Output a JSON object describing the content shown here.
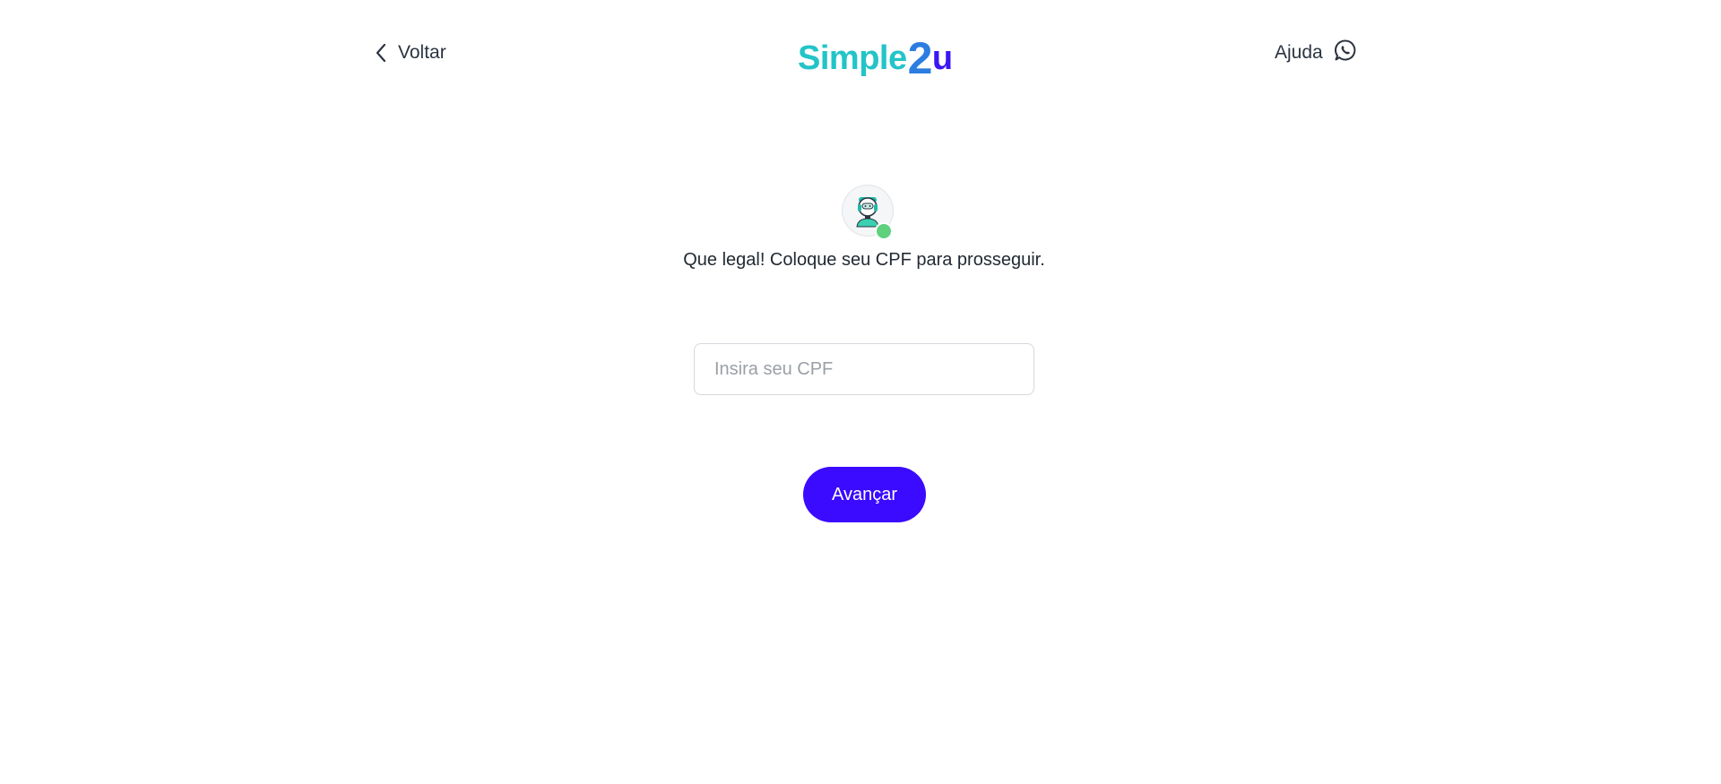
{
  "header": {
    "back_label": "Voltar",
    "help_label": "Ajuda",
    "logo": {
      "word": "Simple",
      "two": "2",
      "u": "u"
    },
    "icons": {
      "back": "chevron-left-icon",
      "help": "whatsapp-icon"
    }
  },
  "assistant": {
    "avatar_icon": "robot-avatar-icon",
    "status": "online"
  },
  "main": {
    "prompt": "Que legal! Coloque seu CPF para prosseguir.",
    "cpf": {
      "placeholder": "Insira seu CPF",
      "value": ""
    },
    "next_label": "Avançar"
  },
  "colors": {
    "brand_teal": "#22c4c8",
    "brand_blue": "#2b7de0",
    "brand_violet": "#3b16f2",
    "primary_button": "#3a0bff",
    "online_dot": "#5ed07e"
  }
}
